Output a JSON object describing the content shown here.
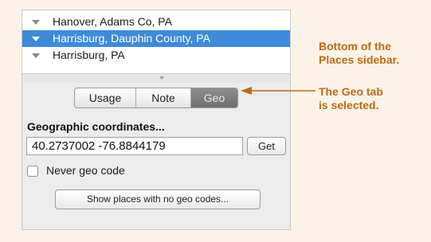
{
  "places_list": {
    "items": [
      {
        "label": "Hanover, Adams Co, PA",
        "selected": false
      },
      {
        "label": "Harrisburg, Dauphin County, PA",
        "selected": true
      },
      {
        "label": "Harrisburg, PA",
        "selected": false
      }
    ]
  },
  "tabs": [
    {
      "label": "Usage",
      "selected": false
    },
    {
      "label": "Note",
      "selected": false
    },
    {
      "label": "Geo",
      "selected": true
    }
  ],
  "geo": {
    "heading": "Geographic coordinates...",
    "coordinates_value": "40.2737002 -76.8844179",
    "get_button": "Get",
    "never_geo_code_label": "Never geo code",
    "never_geo_code_checked": false,
    "show_places_button": "Show places with no geo codes..."
  },
  "annotations": {
    "sidebar_note_line1": "Bottom of the",
    "sidebar_note_line2": "Places sidebar.",
    "tab_note_line1": "The Geo tab",
    "tab_note_line2": "is selected."
  },
  "colors": {
    "selection": "#3d8bd9",
    "annotation": "#bc6a16",
    "background": "#fbf3e7"
  }
}
